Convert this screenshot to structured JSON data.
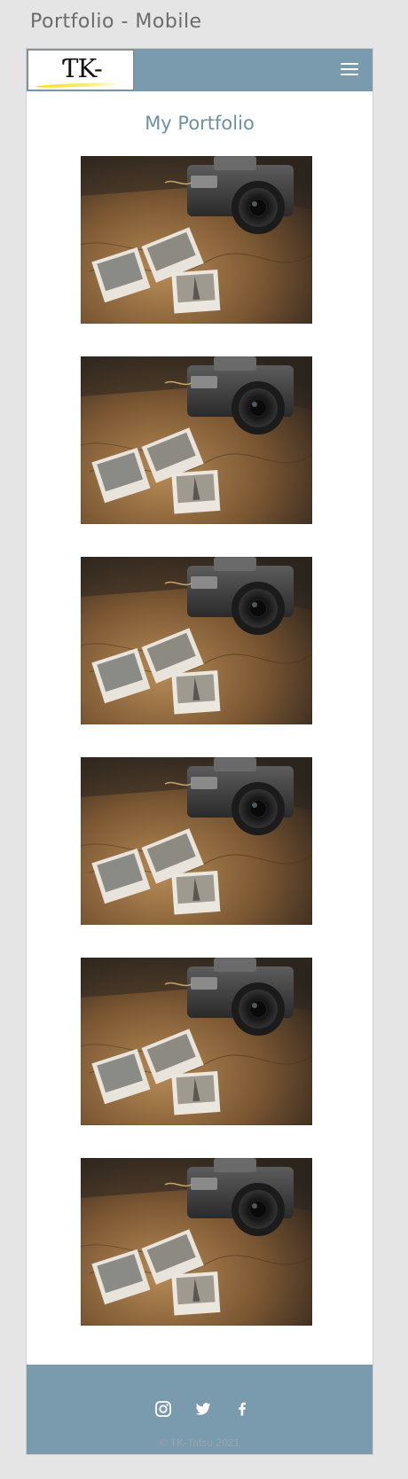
{
  "window": {
    "title": "Portfolio - Mobile"
  },
  "header": {
    "logo_text_pre": "",
    "logo_text_accent": "T",
    "logo_text_brand": "TK-Tatsu",
    "menu_icon": "hamburger-menu-icon",
    "background_color": "#7a9aae"
  },
  "main": {
    "heading": "My Portfolio",
    "gallery": [
      {
        "image": "vintage-camera-with-polaroid-photos"
      },
      {
        "image": "vintage-camera-with-polaroid-photos"
      },
      {
        "image": "vintage-camera-with-polaroid-photos"
      },
      {
        "image": "vintage-camera-with-polaroid-photos"
      },
      {
        "image": "vintage-camera-with-polaroid-photos"
      },
      {
        "image": "vintage-camera-with-polaroid-photos"
      }
    ]
  },
  "footer": {
    "social_icons": [
      "instagram-icon",
      "twitter-icon",
      "facebook-icon"
    ],
    "copyright": "© TK-Tatsu 2021"
  }
}
